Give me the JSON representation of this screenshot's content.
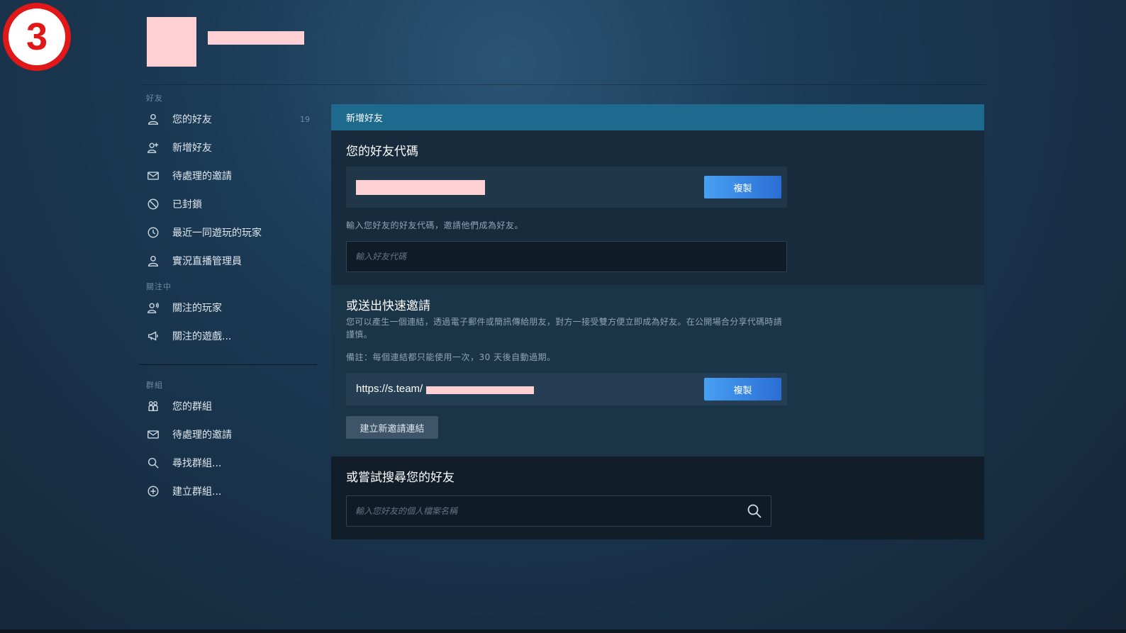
{
  "step_badge": "3",
  "sidebar": {
    "friends_section": "好友",
    "friends_items": [
      {
        "label": "您的好友",
        "count": "19",
        "icon": "person-icon"
      },
      {
        "label": "新增好友",
        "icon": "add-person-icon"
      },
      {
        "label": "待處理的邀請",
        "icon": "envelope-icon"
      },
      {
        "label": "已封鎖",
        "icon": "blocked-icon"
      },
      {
        "label": "最近一同遊玩的玩家",
        "icon": "clock-icon"
      },
      {
        "label": "實況直播管理員",
        "icon": "person-icon"
      }
    ],
    "following_section": "關注中",
    "following_items": [
      {
        "label": "關注的玩家",
        "icon": "followed-person-icon"
      },
      {
        "label": "關注的遊戲...",
        "icon": "megaphone-icon"
      }
    ],
    "groups_section": "群組",
    "groups_items": [
      {
        "label": "您的群組",
        "icon": "group-icon"
      },
      {
        "label": "待處理的邀請",
        "icon": "envelope-icon"
      },
      {
        "label": "尋找群組...",
        "icon": "search-icon"
      },
      {
        "label": "建立群組...",
        "icon": "plus-circle-icon"
      }
    ]
  },
  "panel": {
    "header": "新增好友",
    "friend_code_title": "您的好友代碼",
    "copy_label": "複製",
    "code_hint": "輸入您好友的好友代碼，邀請他們成為好友。",
    "code_input_placeholder": "輸入好友代碼",
    "quick_invite_title": "或送出快速邀請",
    "quick_invite_desc": "您可以產生一個連結，透過電子郵件或簡訊傳給朋友，對方一接受雙方便立即成為好友。在公開場合分享代碼時請謹慎。",
    "quick_invite_note": "備註：每個連結都只能使用一次，30 天後自動過期。",
    "invite_link": "https://s.team/",
    "new_link_label": "建立新邀請連結",
    "search_title": "或嘗試搜尋您的好友",
    "search_placeholder": "輸入您好友的個人檔案名稱"
  }
}
